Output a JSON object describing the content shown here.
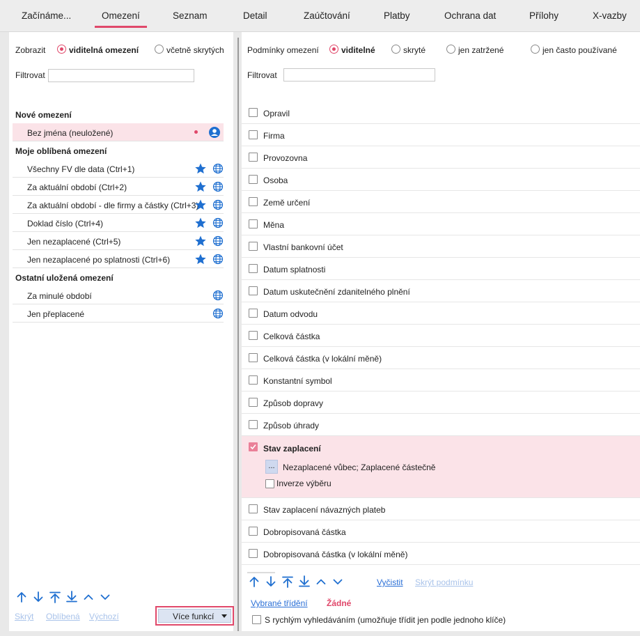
{
  "tabs": [
    {
      "label": "Začínáme..."
    },
    {
      "label": "Omezení"
    },
    {
      "label": "Seznam"
    },
    {
      "label": "Detail"
    },
    {
      "label": "Zaúčtování"
    },
    {
      "label": "Platby"
    },
    {
      "label": "Ochrana dat"
    },
    {
      "label": "Přílohy"
    },
    {
      "label": "X-vazby"
    }
  ],
  "left": {
    "show_label": "Zobrazit",
    "show_opt1": "viditelná omezení",
    "show_opt2": "včetně skrytých",
    "filter_label": "Filtrovat",
    "filter_value": "",
    "section_new": "Nové omezení",
    "new_item": "Bez jména (neuložené)",
    "section_fav": "Moje oblíbená omezení",
    "fav_items": [
      {
        "label": "Všechny FV dle data (Ctrl+1)"
      },
      {
        "label": "Za aktuální období (Ctrl+2)"
      },
      {
        "label": "Za aktuální období - dle firmy a částky (Ctrl+3)"
      },
      {
        "label": "Doklad číslo (Ctrl+4)"
      },
      {
        "label": "Jen nezaplacené (Ctrl+5)"
      },
      {
        "label": "Jen nezaplacené po splatnosti (Ctrl+6)"
      }
    ],
    "section_other": "Ostatní uložená omezení",
    "other_items": [
      {
        "label": "Za minulé období"
      },
      {
        "label": "Jen přeplacené"
      }
    ],
    "btn_hide": "Skrýt",
    "btn_fav": "Oblíbená",
    "btn_default": "Výchozí",
    "btn_more": "Více funkcí"
  },
  "right": {
    "cond_label": "Podmínky omezení",
    "opt_visible": "viditelné",
    "opt_hidden": "skryté",
    "opt_checked": "jen zatržené",
    "opt_frequent": "jen často používané",
    "filter_label": "Filtrovat",
    "filter_value": "",
    "conditions": [
      {
        "label": "Opravil"
      },
      {
        "label": "Firma"
      },
      {
        "label": "Provozovna"
      },
      {
        "label": "Osoba"
      },
      {
        "label": "Země určení"
      },
      {
        "label": "Měna"
      },
      {
        "label": "Vlastní bankovní účet"
      },
      {
        "label": "Datum splatnosti"
      },
      {
        "label": "Datum uskutečnění zdanitelného plnění"
      },
      {
        "label": "Datum odvodu"
      },
      {
        "label": "Celková částka"
      },
      {
        "label": "Celková částka (v lokální měně)"
      },
      {
        "label": "Konstantní symbol"
      },
      {
        "label": "Způsob dopravy"
      },
      {
        "label": "Způsob úhrady"
      }
    ],
    "active_condition": "Stav zaplacení",
    "active_picker": "...",
    "active_value": "Nezaplacené vůbec; Zaplacené částečně",
    "active_inverse": "Inverze výběru",
    "conditions_after": [
      {
        "label": "Stav zaplacení návazných plateb"
      },
      {
        "label": "Dobropisovaná částka"
      },
      {
        "label": "Dobropisovaná částka (v lokální měně)"
      }
    ],
    "btn_clear": "Vyčistit",
    "btn_hide_cond": "Skrýt podmínku",
    "sort_link": "Vybrané třídění",
    "sort_value": "Žádné",
    "quicksearch": "S rychlým vyhledáváním (umožňuje třídit jen podle jednoho klíče)"
  },
  "colors": {
    "accent": "#e0486a",
    "link": "#2a6fd6",
    "icon_blue": "#1f6fd0",
    "selected_bg": "#fbe3e8"
  }
}
